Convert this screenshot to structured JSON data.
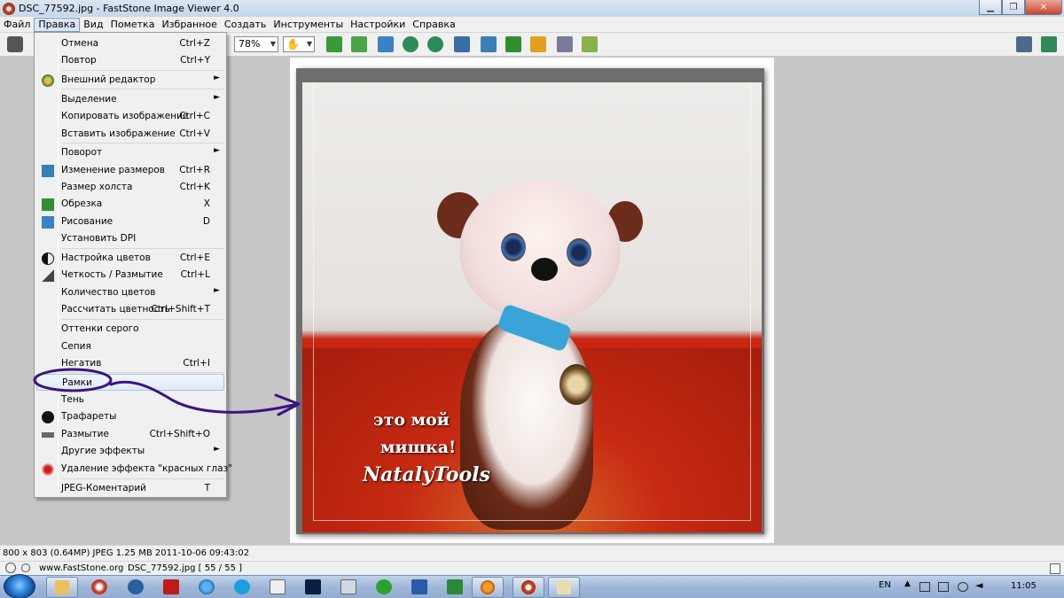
{
  "window": {
    "title": "DSC_77592.jpg  -  FastStone Image Viewer 4.0"
  },
  "menubar": [
    "Файл",
    "Правка",
    "Вид",
    "Пометка",
    "Избранное",
    "Создать",
    "Инструменты",
    "Настройки",
    "Справка"
  ],
  "toolbar": {
    "zoom_value": "78%",
    "zoom_options": [
      "78%"
    ]
  },
  "edit_menu": {
    "items": [
      {
        "label": "Отмена",
        "shortcut": "Ctrl+Z"
      },
      {
        "label": "Повтор",
        "shortcut": "Ctrl+Y"
      },
      {
        "label": "Внешний редактор",
        "shortcut": "",
        "submenu": true,
        "icon": "palette-icon"
      },
      {
        "label": "Выделение",
        "shortcut": "",
        "submenu": true
      },
      {
        "label": "Копировать изображение",
        "shortcut": "Ctrl+C"
      },
      {
        "label": "Вставить изображение",
        "shortcut": "Ctrl+V"
      },
      {
        "label": "Поворот",
        "shortcut": "",
        "submenu": true
      },
      {
        "label": "Изменение размеров",
        "shortcut": "Ctrl+R",
        "icon": "resize-icon"
      },
      {
        "label": "Размер холста",
        "shortcut": "Ctrl+K"
      },
      {
        "label": "Обрезка",
        "shortcut": "X",
        "icon": "crop-icon"
      },
      {
        "label": "Рисование",
        "shortcut": "D",
        "icon": "draw-icon"
      },
      {
        "label": "Установить DPI",
        "shortcut": ""
      },
      {
        "label": "Настройка цветов",
        "shortcut": "Ctrl+E",
        "icon": "color-adjust-icon"
      },
      {
        "label": "Четкость / Размытие",
        "shortcut": "Ctrl+L",
        "icon": "sharpen-icon"
      },
      {
        "label": "Количество цветов",
        "shortcut": "",
        "submenu": true
      },
      {
        "label": "Рассчитать цветность",
        "shortcut": "Ctrl+Shift+T"
      },
      {
        "label": "Оттенки серого",
        "shortcut": ""
      },
      {
        "label": "Сепия",
        "shortcut": ""
      },
      {
        "label": "Негатив",
        "shortcut": "Ctrl+I"
      },
      {
        "label": "Рамки",
        "shortcut": "",
        "highlighted": true
      },
      {
        "label": "Тень",
        "shortcut": ""
      },
      {
        "label": "Трафареты",
        "shortcut": "",
        "icon": "stencil-icon"
      },
      {
        "label": "Размытие",
        "shortcut": "Ctrl+Shift+O",
        "icon": "blur-icon"
      },
      {
        "label": "Другие эффекты",
        "shortcut": "",
        "submenu": true
      },
      {
        "label": "Удаление эффекта \"красных глаз\"",
        "shortcut": "",
        "icon": "red-eye-icon"
      },
      {
        "label": "JPEG-Коментарий",
        "shortcut": "T"
      }
    ]
  },
  "photo": {
    "caption_line1": "это мой",
    "caption_line2": "мишка!",
    "caption_line3": "NatalyTools"
  },
  "status": {
    "image_info": "800 x 803 (0.64MP) JPEG   1.25 MB   2011-10-06 09:43:02",
    "website": "www.FastStone.org",
    "file_position": "DSC_77592.jpg [ 55 / 55 ]"
  },
  "taskbar": {
    "language": "EN",
    "clock": "11:05"
  },
  "colors": {
    "annotation": "#3b1480",
    "menu_highlight": "#a8c4e5",
    "photo_red": "#c8260f"
  }
}
